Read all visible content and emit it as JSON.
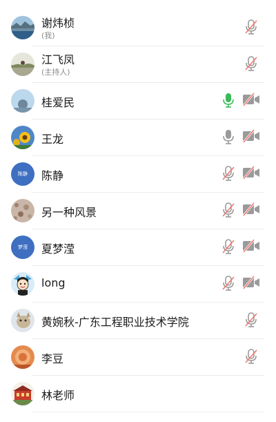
{
  "participants": [
    {
      "name": "谢炜桢",
      "sub": "(我)",
      "avatar": "photo-lake",
      "mic": "muted",
      "camera": "none"
    },
    {
      "name": "江飞凤",
      "sub": "(主持人)",
      "avatar": "photo-field",
      "mic": "muted",
      "camera": "none"
    },
    {
      "name": "桂爱民",
      "sub": "",
      "avatar": "photo-sky",
      "mic": "active",
      "camera": "off"
    },
    {
      "name": "王龙",
      "sub": "",
      "avatar": "photo-sunflower",
      "mic": "on",
      "camera": "off"
    },
    {
      "name": "陈静",
      "sub": "",
      "avatar": "text",
      "avatar_text": "陈静",
      "mic": "muted",
      "camera": "off"
    },
    {
      "name": "另一种风景",
      "sub": "",
      "avatar": "photo-texture",
      "mic": "muted",
      "camera": "off"
    },
    {
      "name": "夏梦滢",
      "sub": "",
      "avatar": "text",
      "avatar_text": "梦滢",
      "mic": "muted",
      "camera": "off"
    },
    {
      "name": "long",
      "sub": "",
      "avatar": "cartoon-boy",
      "mic": "muted",
      "camera": "off"
    },
    {
      "name": "黄婉秋-广东工程职业技术学院",
      "sub": "",
      "avatar": "photo-animal",
      "mic": "muted",
      "camera": "none"
    },
    {
      "name": "李豆",
      "sub": "",
      "avatar": "photo-orange",
      "mic": "muted",
      "camera": "none"
    },
    {
      "name": "林老师",
      "sub": "",
      "avatar": "photo-red-building",
      "mic": "none",
      "camera": "none"
    }
  ],
  "colors": {
    "icon_gray": "#9a9a9a",
    "slash_red": "#f0776f",
    "mic_active_green": "#3cb95a",
    "avatar_blue": "#3e6fc1"
  }
}
